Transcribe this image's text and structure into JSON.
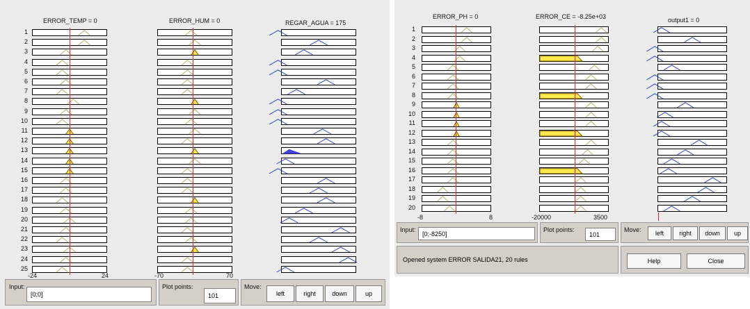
{
  "window1": {
    "columns": [
      {
        "title": "ERROR_TEMP = 0",
        "min_label": "-24",
        "max_label": "24"
      },
      {
        "title": "ERROR_HUM = 0",
        "min_label": "-70",
        "max_label": "70"
      },
      {
        "title": "REGAR_AGUA = 175",
        "min_label": "",
        "max_label": ""
      }
    ],
    "rows": [
      "1",
      "2",
      "3",
      "4",
      "5",
      "6",
      "7",
      "8",
      "9",
      "10",
      "11",
      "12",
      "13",
      "14",
      "15",
      "16",
      "17",
      "18",
      "19",
      "20",
      "21",
      "22",
      "23",
      "24",
      "25"
    ],
    "controls": {
      "input_label": "Input:",
      "input_value": "[0;0]",
      "plot_points_label": "Plot points:",
      "plot_points_value": "101",
      "move_label": "Move:",
      "buttons": [
        "left",
        "right",
        "down",
        "up"
      ]
    }
  },
  "window2": {
    "columns": [
      {
        "title": "ERROR_PH = 0",
        "min_label": "-8",
        "max_label": "8"
      },
      {
        "title": "ERROR_CE = -8.25e+03",
        "min_label": "-20000",
        "max_label": "3500"
      },
      {
        "title": "output1 = 0",
        "min_label": "",
        "max_label": ""
      }
    ],
    "rows": [
      "1",
      "2",
      "3",
      "4",
      "5",
      "6",
      "7",
      "8",
      "9",
      "10",
      "11",
      "12",
      "13",
      "14",
      "15",
      "16",
      "17",
      "18",
      "19",
      "20"
    ],
    "controls": {
      "input_label": "Input:",
      "input_value": "[0;-8250]",
      "plot_points_label": "Plot points:",
      "plot_points_value": "101",
      "move_label": "Move:",
      "buttons": [
        "left",
        "right",
        "down",
        "up"
      ],
      "status_text": "Opened system ERROR SALIDA21, 20 rules",
      "help_label": "Help",
      "close_label": "Close"
    }
  },
  "colors": {
    "panel_bg": "#ececec",
    "control_bg": "#d4d0c8",
    "indicator_line": "#ff2020",
    "fired_input": "#ffe94d",
    "output_fill": "#4040dd",
    "mf_input": "#b8b070",
    "mf_output": "#2a3fd0"
  }
}
